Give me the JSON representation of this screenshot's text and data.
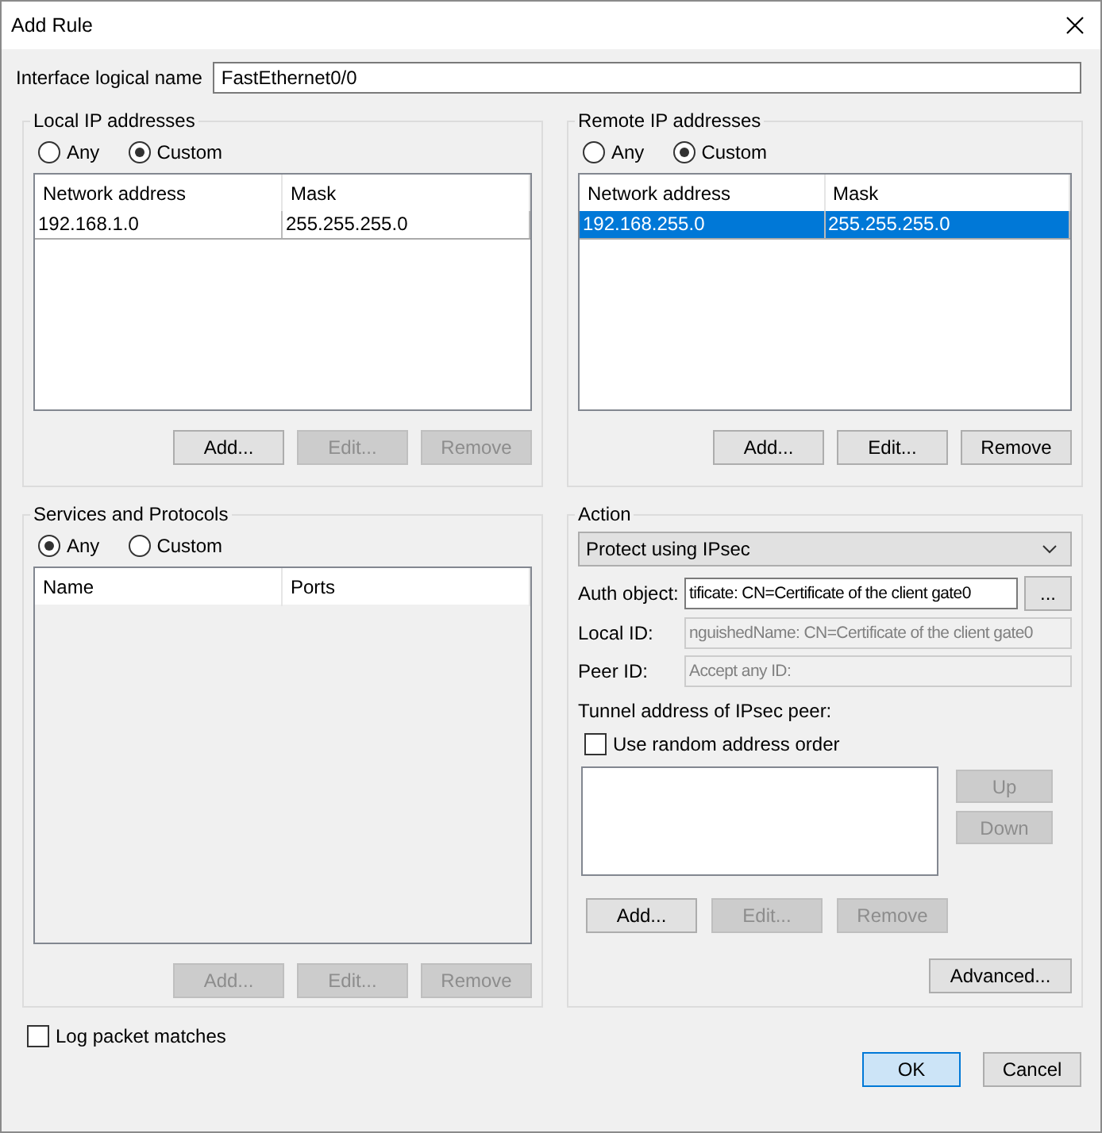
{
  "window": {
    "title": "Add Rule"
  },
  "interface_name": {
    "label": "Interface logical name",
    "value": "FastEthernet0/0"
  },
  "local_ip": {
    "title": "Local IP addresses",
    "radios": [
      {
        "label": "Any",
        "selected": false
      },
      {
        "label": "Custom",
        "selected": true
      }
    ],
    "list_disabled": false,
    "columns": [
      "Network address",
      "Mask"
    ],
    "rows": [
      {
        "cells": [
          "192.168.1.0",
          "255.255.255.0"
        ],
        "selected": false
      }
    ],
    "buttons": [
      {
        "label": "Add...",
        "disabled": false
      },
      {
        "label": "Edit...",
        "disabled": true
      },
      {
        "label": "Remove",
        "disabled": true
      }
    ]
  },
  "remote_ip": {
    "title": "Remote IP addresses",
    "radios": [
      {
        "label": "Any",
        "selected": false
      },
      {
        "label": "Custom",
        "selected": true
      }
    ],
    "list_disabled": false,
    "columns": [
      "Network address",
      "Mask"
    ],
    "rows": [
      {
        "cells": [
          "192.168.255.0",
          "255.255.255.0"
        ],
        "selected": true
      }
    ],
    "buttons": [
      {
        "label": "Add...",
        "disabled": false
      },
      {
        "label": "Edit...",
        "disabled": false
      },
      {
        "label": "Remove",
        "disabled": false
      }
    ]
  },
  "services": {
    "title": "Services and Protocols",
    "radios": [
      {
        "label": "Any",
        "selected": true
      },
      {
        "label": "Custom",
        "selected": false
      }
    ],
    "list_disabled": true,
    "columns": [
      "Name",
      "Ports"
    ],
    "buttons": [
      {
        "label": "Add...",
        "disabled": true
      },
      {
        "label": "Edit...",
        "disabled": true
      },
      {
        "label": "Remove",
        "disabled": true
      }
    ]
  },
  "action": {
    "title": "Action",
    "dropdown": "Protect using IPsec",
    "fields": [
      {
        "label": "Auth object:",
        "value": "tificate: CN=Certificate of the client gate0",
        "disabled": false
      },
      {
        "label": "Local ID:",
        "value": "nguishedName: CN=Certificate of the client gate0",
        "disabled": true
      },
      {
        "label": "Peer ID:",
        "value": "Accept any ID:",
        "disabled": true
      }
    ],
    "browse_button": "...",
    "tunnel_label": "Tunnel address of IPsec peer:",
    "random_order": {
      "label": "Use random address order",
      "checked": false
    },
    "side_buttons": [
      {
        "label": "Up",
        "disabled": true
      },
      {
        "label": "Down",
        "disabled": true
      }
    ],
    "buttons": [
      {
        "label": "Add...",
        "disabled": false
      },
      {
        "label": "Edit...",
        "disabled": true
      },
      {
        "label": "Remove",
        "disabled": true
      }
    ],
    "advanced_button": "Advanced..."
  },
  "log_packets": {
    "label": "Log packet matches",
    "checked": false
  },
  "footer_buttons": [
    {
      "label": "OK",
      "default": true
    },
    {
      "label": "Cancel",
      "default": false
    }
  ]
}
